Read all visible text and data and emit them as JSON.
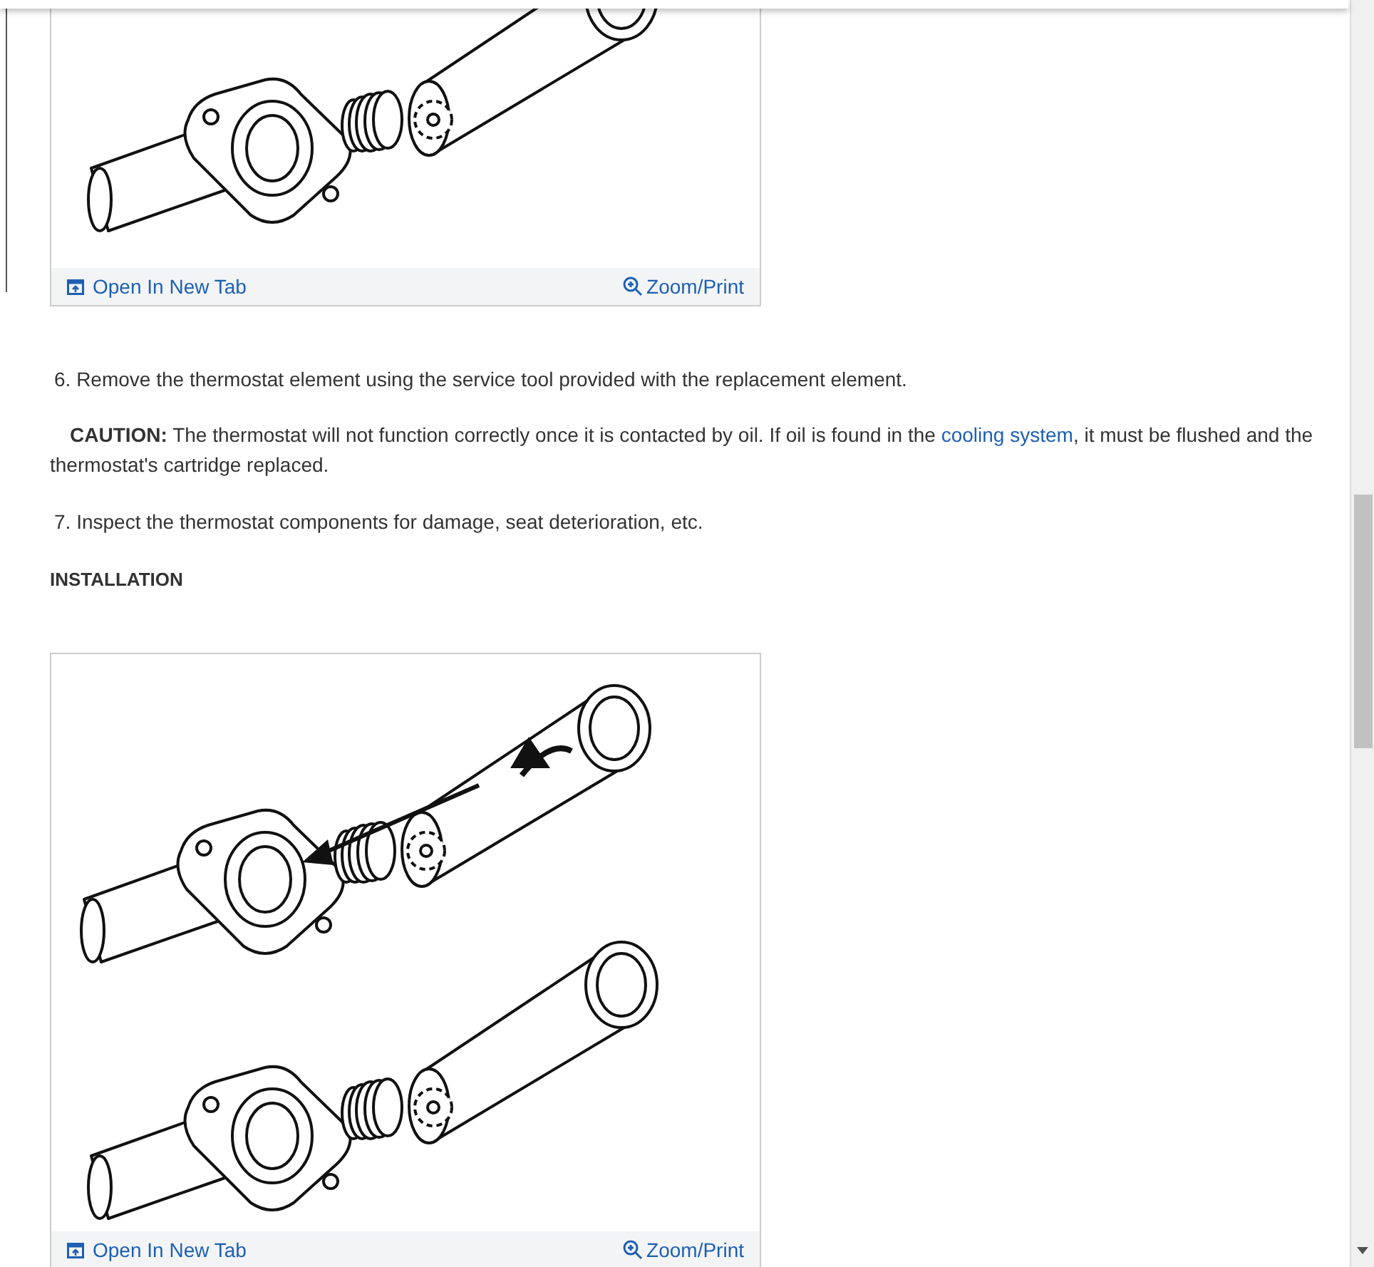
{
  "figures": [
    {
      "kind": "removal",
      "open_link": "Open In New Tab",
      "zoom_link": "Zoom/Print"
    },
    {
      "kind": "installation",
      "open_link": "Open In New Tab",
      "zoom_link": "Zoom/Print"
    }
  ],
  "blocks": [
    {
      "kind": "step",
      "text": "6. Remove the thermostat element using the service tool provided with the replacement element."
    },
    {
      "kind": "caution",
      "label": "CAUTION:",
      "text_before": "The thermostat will not function correctly once it is contacted by oil. If oil is found in the ",
      "link": "cooling system",
      "text_after": ", it must be flushed and the thermostat's cartridge replaced."
    },
    {
      "kind": "step",
      "text": "7. Inspect the thermostat components for damage, seat deterioration, etc."
    },
    {
      "kind": "heading",
      "text": "INSTALLATION"
    }
  ]
}
